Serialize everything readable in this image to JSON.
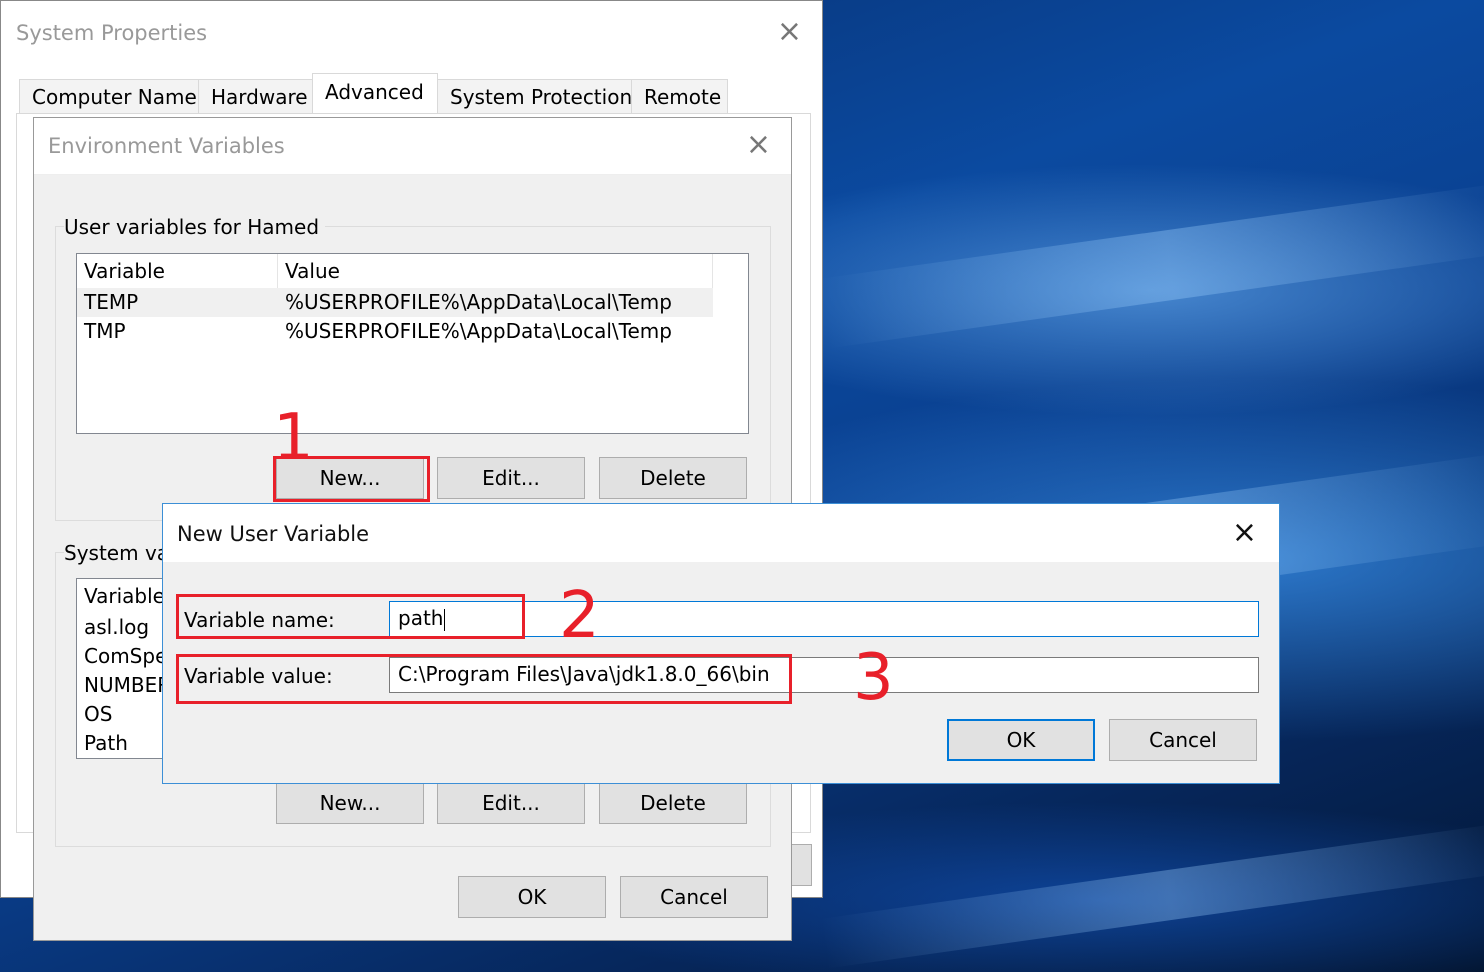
{
  "system_properties": {
    "title": "System Properties",
    "tabs": [
      {
        "label": "Computer Name",
        "active": false
      },
      {
        "label": "Hardware",
        "active": false
      },
      {
        "label": "Advanced",
        "active": true
      },
      {
        "label": "System Protection",
        "active": false
      },
      {
        "label": "Remote",
        "active": false
      }
    ]
  },
  "environment_variables": {
    "title": "Environment Variables",
    "user_group_label": "User variables for Hamed",
    "user_columns": [
      "Variable",
      "Value"
    ],
    "user_rows": [
      {
        "variable": "TEMP",
        "value": "%USERPROFILE%\\AppData\\Local\\Temp",
        "selected": true
      },
      {
        "variable": "TMP",
        "value": "%USERPROFILE%\\AppData\\Local\\Temp",
        "selected": false
      }
    ],
    "user_buttons": {
      "new": "New...",
      "edit": "Edit...",
      "delete": "Delete"
    },
    "system_group_label": "System va",
    "system_columns": [
      "Variable"
    ],
    "system_rows": [
      "asl.log",
      "ComSpe",
      "NUMBER",
      "OS",
      "Path"
    ],
    "system_buttons": {
      "new": "New...",
      "edit": "Edit...",
      "delete": "Delete"
    },
    "ok": "OK",
    "cancel": "Cancel"
  },
  "new_user_variable": {
    "title": "New User Variable",
    "name_label": "Variable name:",
    "name_value": "path",
    "value_label": "Variable value:",
    "value_value": "C:\\Program Files\\Java\\jdk1.8.0_66\\bin",
    "ok": "OK",
    "cancel": "Cancel"
  },
  "annotations": {
    "step1": "1",
    "step2": "2",
    "step3": "3",
    "highlight_color": "#e8202a"
  },
  "icons": {
    "close": "×"
  },
  "colors": {
    "accent": "#0078d7",
    "button_face": "#e1e1e1",
    "dialog_bg": "#f0f0f0"
  }
}
